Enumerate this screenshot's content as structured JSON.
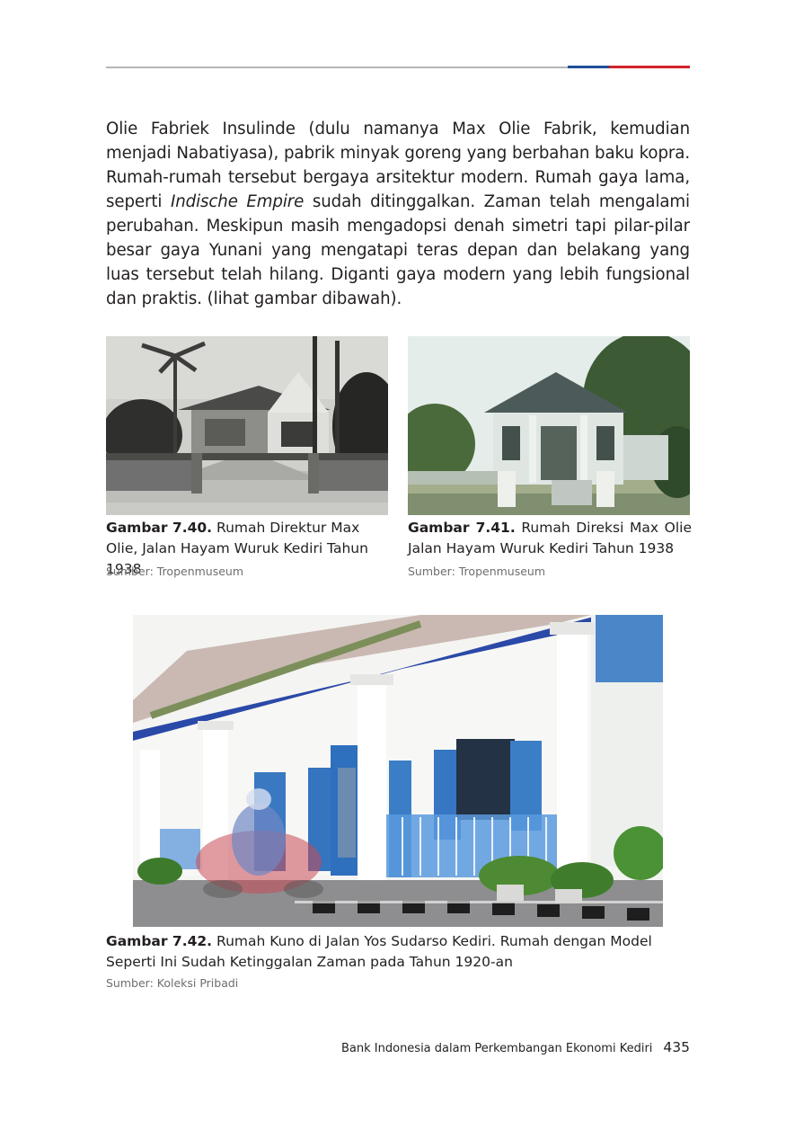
{
  "header": {
    "rule_colors": {
      "gray": "#b5b5b5",
      "blue": "#1f4e9b",
      "red": "#d2232a"
    }
  },
  "paragraph": {
    "part1": "Olie Fabriek Insulinde (dulu namanya Max Olie Fabrik, kemudian menjadi Nabatiyasa), pabrik minyak goreng yang berbahan baku kopra. Rumah-rumah tersebut bergaya arsitektur modern. Rumah gaya lama, seperti ",
    "italic": "Indische Empire",
    "part2": " sudah ditinggalkan. Zaman telah mengalami perubahan. Meskipun masih mengadopsi denah simetri tapi pilar-pilar besar gaya Yunani yang mengatapi teras depan dan belakang yang luas tersebut telah hilang. Diganti gaya modern yang lebih fungsional dan praktis. (lihat gambar dibawah)."
  },
  "figures": [
    {
      "label": "Gambar 7.40.",
      "caption": " Rumah Direktur Max Olie, Jalan Hayam Wuruk Kediri Tahun 1938",
      "source": "Sumber: Tropenmuseum",
      "image": "black-and-white photo of colonial house with palm trees"
    },
    {
      "label": "Gambar 7.41.",
      "caption": " Rumah Direksi Max Olie Jalan Hayam Wuruk Kediri Tahun 1938",
      "source": "Sumber: Tropenmuseum",
      "image": "faded color photo of colonial house with trees"
    },
    {
      "label": "Gambar 7.42.",
      "caption": " Rumah Kuno di Jalan Yos Sudarso Kediri. Rumah dengan Model Seperti Ini Sudah Ketinggalan Zaman pada Tahun 1920-an",
      "source": "Sumber: Koleksi Pribadi",
      "image": "white house with blue doors and columns, motorcyclist passing"
    }
  ],
  "footer": {
    "title": "Bank Indonesia dalam Perkembangan Ekonomi Kediri",
    "page_number": "435"
  }
}
